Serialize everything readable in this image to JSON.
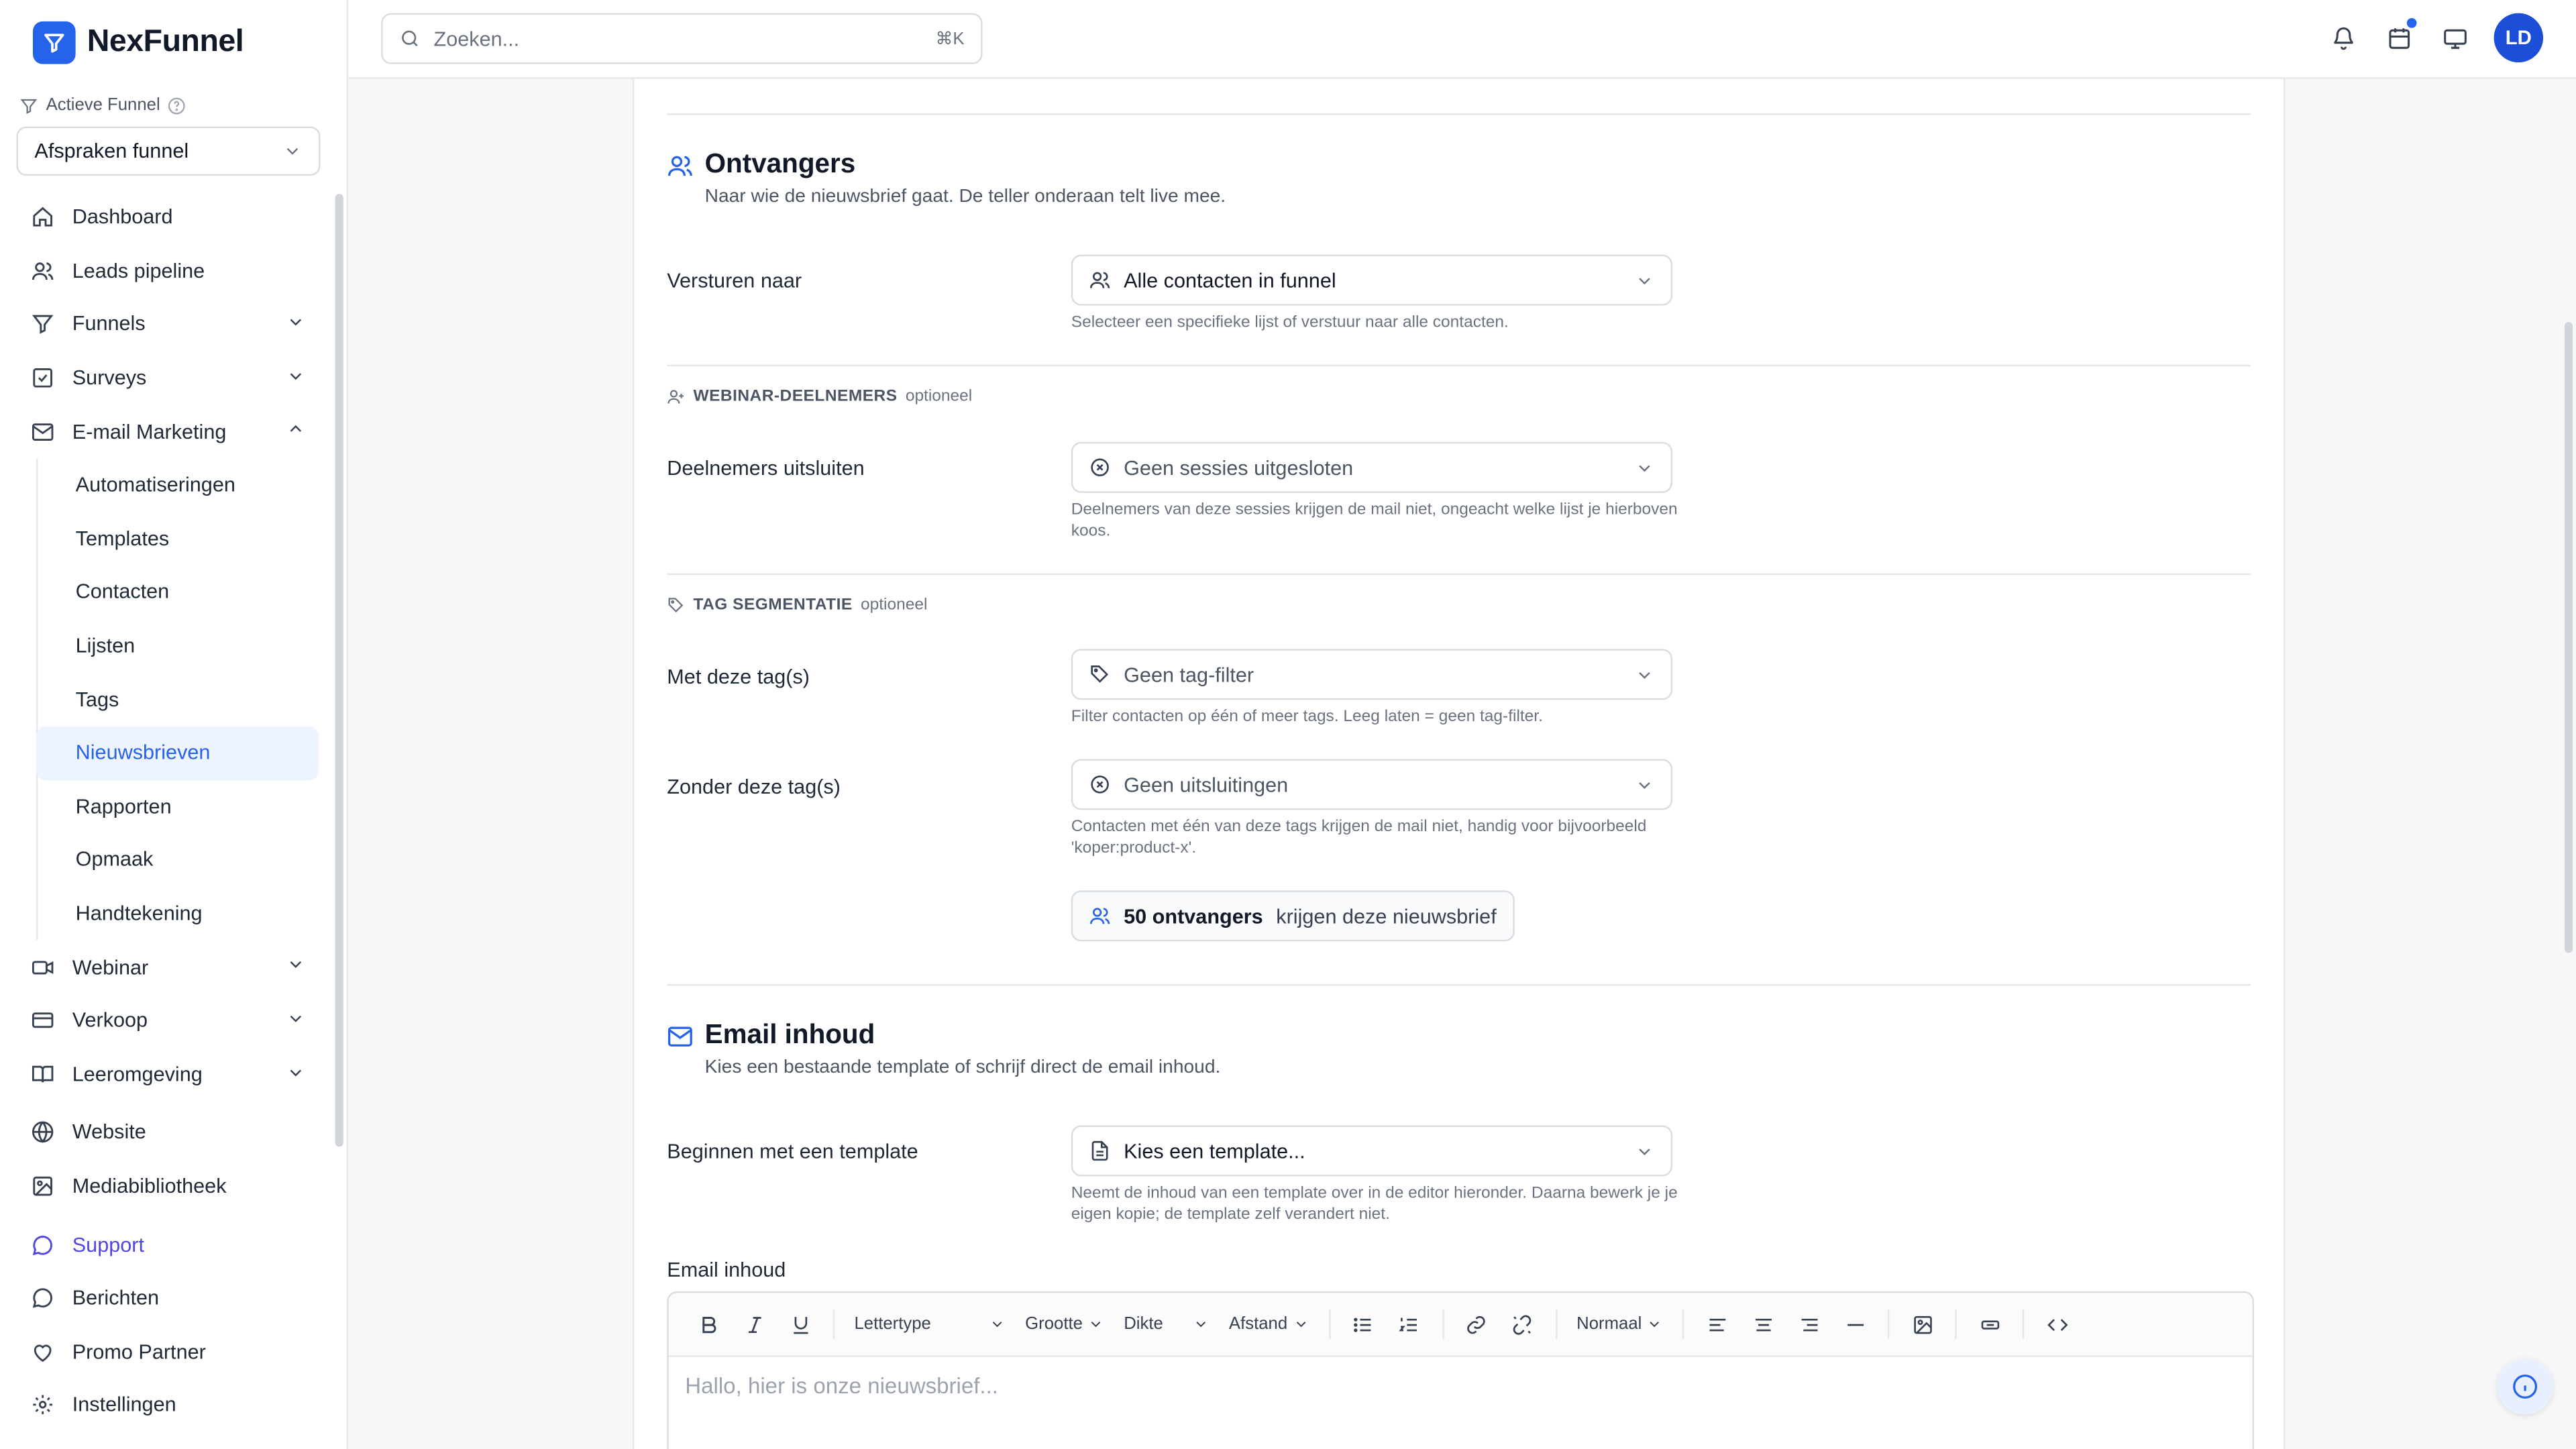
{
  "app": {
    "name": "NexFunnel",
    "brand_color": "#2563eb"
  },
  "sidebar": {
    "active_funnel_label": "Actieve Funnel",
    "funnel_selected": "Afspraken funnel",
    "items": {
      "dashboard": "Dashboard",
      "leads": "Leads pipeline",
      "funnels": "Funnels",
      "surveys": "Surveys",
      "email_marketing": "E-mail Marketing",
      "webinar": "Webinar",
      "verkoop": "Verkoop",
      "leeromgeving": "Leeromgeving",
      "website": "Website",
      "media": "Mediabibliotheek",
      "support": "Support",
      "berichten": "Berichten",
      "promo": "Promo Partner",
      "instellingen": "Instellingen"
    },
    "email_sub": {
      "automatiseringen": "Automatiseringen",
      "templates": "Templates",
      "contacten": "Contacten",
      "lijsten": "Lijsten",
      "tags": "Tags",
      "nieuwsbrieven": "Nieuwsbrieven",
      "rapporten": "Rapporten",
      "opmaak": "Opmaak",
      "handtekening": "Handtekening"
    }
  },
  "header": {
    "search_placeholder": "Zoeken...",
    "search_shortcut": "⌘K",
    "avatar_initials": "LD"
  },
  "recipients": {
    "title": "Ontvangers",
    "subtitle": "Naar wie de nieuwsbrief gaat. De teller onderaan telt live mee.",
    "send_to_label": "Versturen naar",
    "send_to_value": "Alle contacten in funnel",
    "send_to_help": "Selecteer een specifieke lijst of verstuur naar alle contacten.",
    "webinar_group": "WEBINAR-DEELNEMERS",
    "optional": "optioneel",
    "exclude_label": "Deelnemers uitsluiten",
    "exclude_value": "Geen sessies uitgesloten",
    "exclude_help": "Deelnemers van deze sessies krijgen de mail niet, ongeacht welke lijst je hierboven koos.",
    "tag_group": "TAG SEGMENTATIE",
    "with_tags_label": "Met deze tag(s)",
    "with_tags_value": "Geen tag-filter",
    "with_tags_help": "Filter contacten op één of meer tags. Leeg laten = geen tag-filter.",
    "without_tags_label": "Zonder deze tag(s)",
    "without_tags_value": "Geen uitsluitingen",
    "without_tags_help": "Contacten met één van deze tags krijgen de mail niet, handig voor bijvoorbeeld 'koper:product-x'.",
    "counter_bold": "50 ontvangers",
    "counter_rest": "krijgen deze nieuwsbrief"
  },
  "email_content": {
    "title": "Email inhoud",
    "subtitle": "Kies een bestaande template of schrijf direct de email inhoud.",
    "template_label": "Beginnen met een template",
    "template_value": "Kies een template...",
    "template_help": "Neemt de inhoud van een template over in de editor hieronder. Daarna bewerk je je eigen kopie; de template zelf verandert niet.",
    "editor_label": "Email inhoud",
    "toolbar": {
      "font": "Lettertype",
      "size": "Grootte",
      "weight": "Dikte",
      "spacing": "Afstand",
      "block": "Normaal"
    },
    "editor_placeholder": "Hallo, hier is onze nieuwsbrief..."
  }
}
